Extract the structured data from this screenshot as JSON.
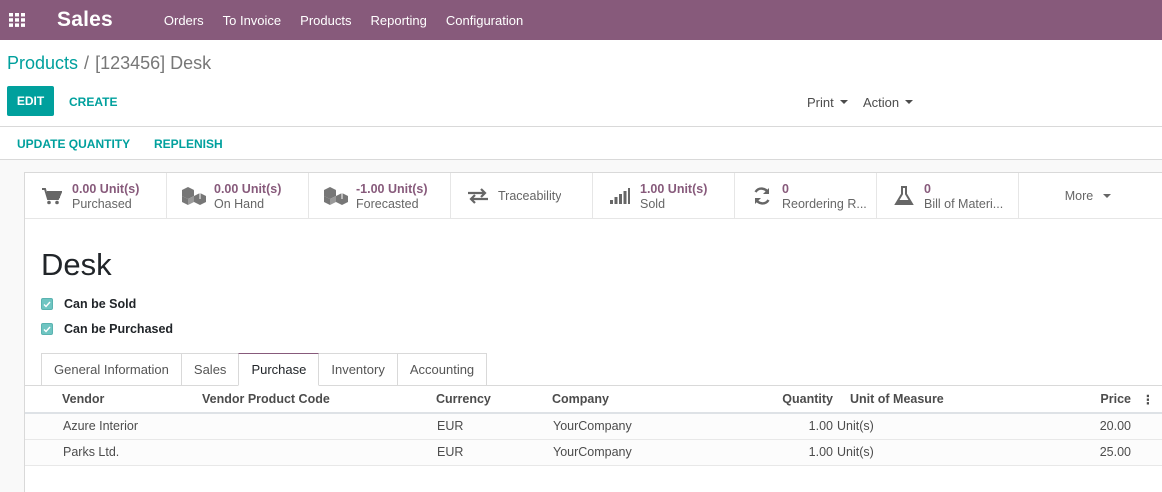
{
  "navbar": {
    "brand": "Sales",
    "menu": [
      "Orders",
      "To Invoice",
      "Products",
      "Reporting",
      "Configuration"
    ]
  },
  "breadcrumb": {
    "parent": "Products",
    "separator": "/",
    "current": "[123456] Desk"
  },
  "toolbar": {
    "edit": "EDIT",
    "create": "CREATE",
    "print": "Print",
    "action": "Action"
  },
  "statusbar": {
    "update_quantity": "UPDATE QUANTITY",
    "replenish": "REPLENISH"
  },
  "smart_buttons": [
    {
      "icon": "shopping-cart-icon",
      "value": "0.00 Unit(s)",
      "label": "Purchased"
    },
    {
      "icon": "cubes-icon",
      "value": "0.00 Unit(s)",
      "label": "On Hand"
    },
    {
      "icon": "cubes-icon",
      "value": "-1.00 Unit(s)",
      "label": "Forecasted"
    },
    {
      "icon": "exchange-arrows-icon",
      "value": "",
      "label": "Traceability"
    },
    {
      "icon": "signal-bars-icon",
      "value": "1.00 Unit(s)",
      "label": "Sold"
    },
    {
      "icon": "refresh-icon",
      "value": "0",
      "label": "Reordering R..."
    },
    {
      "icon": "flask-icon",
      "value": "0",
      "label": "Bill of Materi..."
    },
    {
      "icon": "",
      "value": "",
      "label": "More"
    }
  ],
  "product": {
    "name": "Desk",
    "can_be_sold_label": "Can be Sold",
    "can_be_purchased_label": "Can be Purchased"
  },
  "tabs": [
    "General Information",
    "Sales",
    "Purchase",
    "Inventory",
    "Accounting"
  ],
  "active_tab": "Purchase",
  "vendor_table": {
    "columns": [
      "Vendor",
      "Vendor Product Code",
      "Currency",
      "Company",
      "Quantity",
      "Unit of Measure",
      "Price"
    ],
    "rows": [
      [
        "Azure Interior",
        "",
        "EUR",
        "YourCompany",
        "1.00",
        "Unit(s)",
        "20.00"
      ],
      [
        "Parks Ltd.",
        "",
        "EUR",
        "YourCompany",
        "1.00",
        "Unit(s)",
        "25.00"
      ]
    ]
  },
  "colors": {
    "brand": "#875a7b",
    "accent": "#00a09d"
  }
}
